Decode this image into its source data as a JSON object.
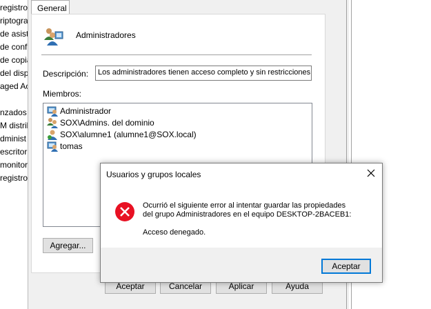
{
  "left_list": {
    "items": [
      "registro",
      "riptograf",
      "de asiste",
      "de config",
      "de copia",
      "del dispo",
      "aged Ac",
      "nzados",
      "M distrib",
      "dminist",
      "escritorio",
      "monitor",
      "registro"
    ]
  },
  "properties": {
    "tab_label": "General",
    "group_name": "Administradores",
    "description_label": "Descripción:",
    "description_value": "Los administradores tienen acceso completo y sin restricciones al",
    "members_label": "Miembros:",
    "members": [
      {
        "name": "Administrador",
        "icon": "user-icon"
      },
      {
        "name": "SOX\\Admins. del dominio",
        "icon": "group-icon"
      },
      {
        "name": "SOX\\alumne1 (alumne1@SOX.local)",
        "icon": "domain-user-icon"
      },
      {
        "name": "tomas",
        "icon": "user-icon"
      }
    ],
    "add_button": "Agregar...",
    "ok_button": "Aceptar",
    "cancel_button": "Cancelar",
    "apply_button": "Aplicar",
    "help_button": "Ayuda"
  },
  "error_dialog": {
    "title": "Usuarios y grupos locales",
    "message_line1": "Ocurrió el siguiente error al intentar  guardar las propiedades",
    "message_line2": "del grupo Administradores en el equipo DESKTOP-2BACEB1:",
    "message_line3": "Acceso denegado.",
    "ok_button": "Aceptar",
    "icon": "error-icon",
    "error_color": "#e81123",
    "focus_color": "#0078d7"
  }
}
